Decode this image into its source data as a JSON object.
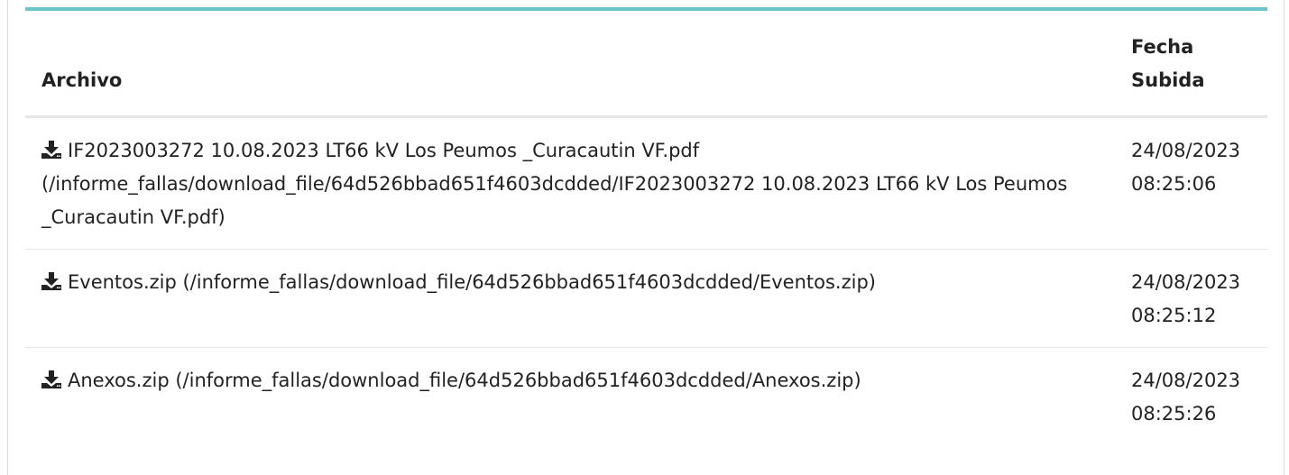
{
  "table": {
    "headers": {
      "file": "Archivo",
      "date_line1": "Fecha",
      "date_line2": "Subida"
    },
    "rows": [
      {
        "icon": "download-icon",
        "link_text": "IF2023003272 10.08.2023 LT66 kV Los Peumos _Curacautin VF.pdf (/informe_fallas/download_file/64d526bbad651f4603dcdded/IF2023003272 10.08.2023 LT66 kV Los Peumos _Curacautin VF.pdf)",
        "date": "24/08/2023",
        "time": "08:25:06"
      },
      {
        "icon": "download-icon",
        "link_text": "Eventos.zip (/informe_fallas/download_file/64d526bbad651f4603dcdded/Eventos.zip)",
        "date": "24/08/2023",
        "time": "08:25:12"
      },
      {
        "icon": "download-icon",
        "link_text": "Anexos.zip (/informe_fallas/download_file/64d526bbad651f4603dcdded/Anexos.zip)",
        "date": "24/08/2023",
        "time": "08:25:26"
      }
    ]
  },
  "colors": {
    "accent": "#6cc5c9",
    "text": "#222222",
    "divider": "#e6e6e6"
  }
}
